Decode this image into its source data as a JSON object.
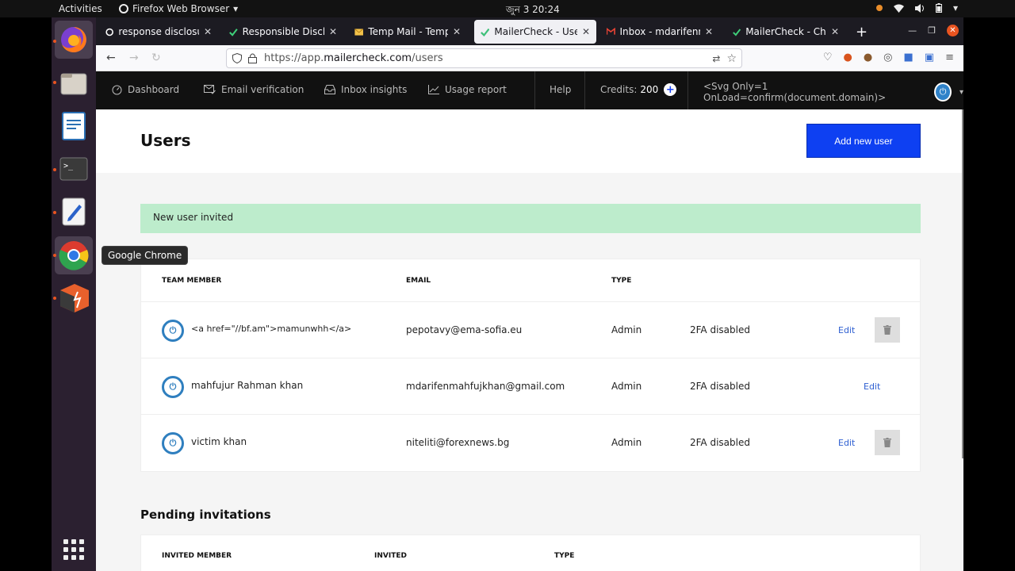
{
  "topbar": {
    "activities": "Activities",
    "app_name": "Firefox Web Browser",
    "clock": "জুন 3  20:24"
  },
  "dock": {
    "tooltip": "Google Chrome"
  },
  "tabs": [
    {
      "title": "response disclosure r",
      "icon": "google-icon"
    },
    {
      "title": "Responsible Disclosu",
      "icon": "check-icon"
    },
    {
      "title": "Temp Mail - Tempora",
      "icon": "mail-icon"
    },
    {
      "title": "MailerCheck - Users",
      "icon": "check-icon"
    },
    {
      "title": "Inbox - mdarifenmah",
      "icon": "gmail-icon"
    },
    {
      "title": "MailerCheck - Choose",
      "icon": "check-icon"
    }
  ],
  "url": {
    "prefix": "https://app.",
    "domain": "mailercheck.com",
    "path": "/users"
  },
  "appnav": {
    "dashboard": "Dashboard",
    "email_verification": "Email verification",
    "inbox_insights": "Inbox insights",
    "usage_report": "Usage report",
    "help": "Help",
    "credits_label": "Credits:",
    "credits_value": "200",
    "account_name": "<Svg Only=1 OnLoad=confirm(document.domain)>"
  },
  "page": {
    "title": "Users",
    "add_button": "Add new user",
    "alert": "New user invited"
  },
  "users_table": {
    "headers": [
      "TEAM MEMBER",
      "EMAIL",
      "TYPE"
    ],
    "edit_label": "Edit",
    "rows": [
      {
        "name": "<a href=\"//bf.am\">mamunwhh</a>",
        "email": "pepotavy@ema-sofia.eu",
        "type": "Admin",
        "twofa": "2FA disabled"
      },
      {
        "name": "mahfujur Rahman khan",
        "email": "mdarifenmahfujkhan@gmail.com",
        "type": "Admin",
        "twofa": "2FA disabled"
      },
      {
        "name": "victim khan",
        "email": "niteliti@forexnews.bg",
        "type": "Admin",
        "twofa": "2FA disabled"
      }
    ]
  },
  "pending": {
    "title": "Pending invitations",
    "headers": [
      "INVITED MEMBER",
      "INVITED",
      "TYPE"
    ]
  }
}
